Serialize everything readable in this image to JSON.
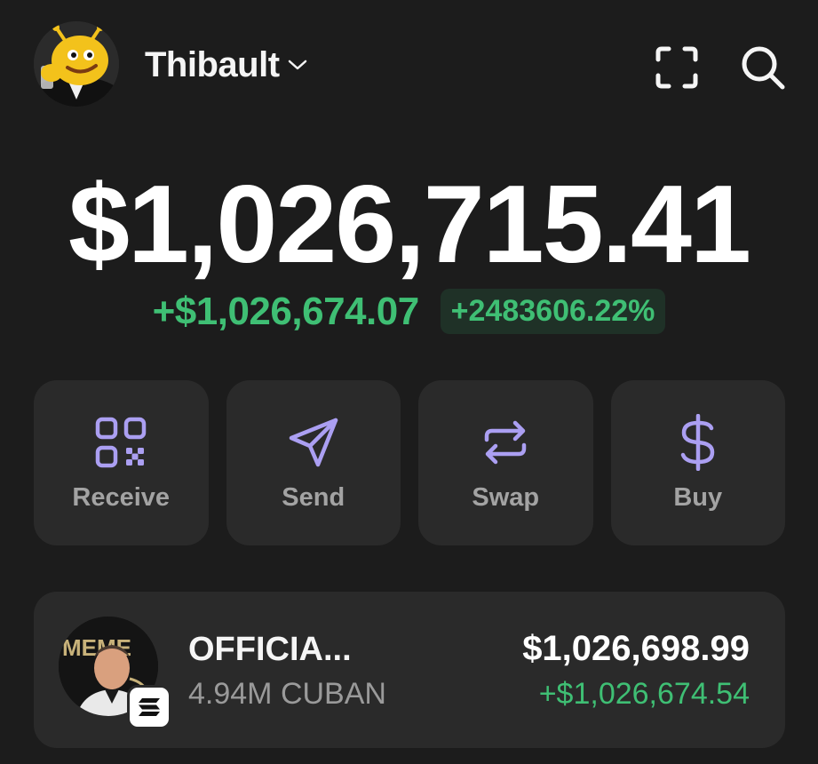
{
  "header": {
    "account_name": "Thibault",
    "avatar_icon": "cartoon-avatar",
    "scan_icon": "scan-icon",
    "search_icon": "search-icon"
  },
  "portfolio": {
    "balance": "$1,026,715.41",
    "change_amount": "+$1,026,674.07",
    "change_percent": "+2483606.22%"
  },
  "actions": [
    {
      "label": "Receive",
      "icon": "qr-code-icon"
    },
    {
      "label": "Send",
      "icon": "send-icon"
    },
    {
      "label": "Swap",
      "icon": "swap-icon"
    },
    {
      "label": "Buy",
      "icon": "dollar-icon"
    }
  ],
  "tokens": [
    {
      "name": "OFFICIA...",
      "amount": "4.94M CUBAN",
      "value": "$1,026,698.99",
      "change": "+$1,026,674.54",
      "avatar_text": "MEME",
      "chain_icon": "solana-icon"
    }
  ],
  "colors": {
    "background": "#1c1c1c",
    "card": "#2a2a2a",
    "accent": "#ab9ff2",
    "positive": "#3fbf74"
  }
}
